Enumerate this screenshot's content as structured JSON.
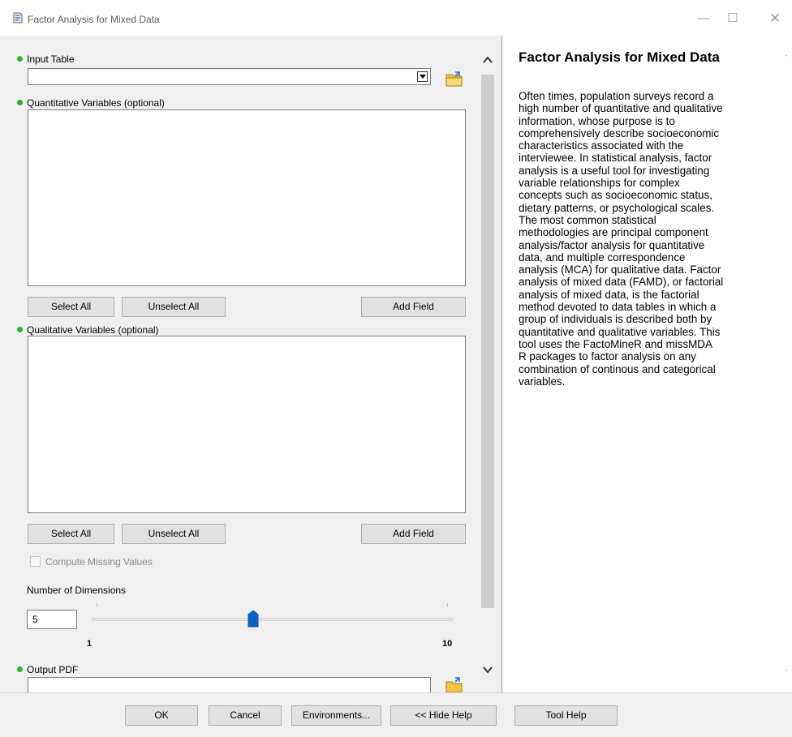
{
  "window": {
    "title": "Factor Analysis for Mixed Data",
    "minimize_icon": "minimize-icon",
    "maximize_icon": "maximize-icon",
    "close_icon": "close-icon"
  },
  "form": {
    "input_table_label": "Input Table",
    "input_table_value": "",
    "quant_label": "Quantitative Variables (optional)",
    "qual_label": "Qualitative Variables (optional)",
    "select_all": "Select All",
    "unselect_all": "Unselect All",
    "add_field": "Add Field",
    "compute_missing_label": "Compute Missing Values",
    "compute_missing_checked": false,
    "dimensions_label": "Number of Dimensions",
    "dimensions_value": "5",
    "slider_min": "1",
    "slider_max": "10",
    "output_pdf_label": "Output PDF",
    "output_pdf_value": ""
  },
  "help": {
    "title": "Factor Analysis for Mixed Data",
    "lines": [
      "Often times, population surveys record a",
      "high number of quantitative and qualitative",
      "information, whose purpose is to",
      "comprehensively describe socioeconomic",
      "characteristics associated with the",
      "interviewee. In statistical analysis, factor",
      "analysis is a useful tool for investigating",
      "variable relationships for complex",
      "concepts such as socioeconomic status,",
      "dietary patterns, or psychological scales.",
      "The most common statistical",
      "methodologies are principal component",
      "analysis/factor analysis for quantitative",
      "data, and multiple correspondence",
      "analysis (MCA) for qualitative data. Factor",
      "analysis of mixed data (FAMD), or factorial",
      "analysis of mixed data, is the factorial",
      "method devoted to data tables in which a",
      "group of individuals is described both by",
      "quantitative and qualitative variables. This",
      "tool uses the FactoMineR and missMDA",
      "R packages to factor analysis on any",
      "combination of continous and categorical",
      "variables."
    ]
  },
  "footer": {
    "ok": "OK",
    "cancel": "Cancel",
    "environments": "Environments...",
    "hide_help": "<< Hide Help",
    "tool_help": "Tool Help"
  },
  "colors": {
    "required_dot": "#2cb52c",
    "slider_thumb": "#0a64c8",
    "pane_bg": "#f0f0f0"
  }
}
